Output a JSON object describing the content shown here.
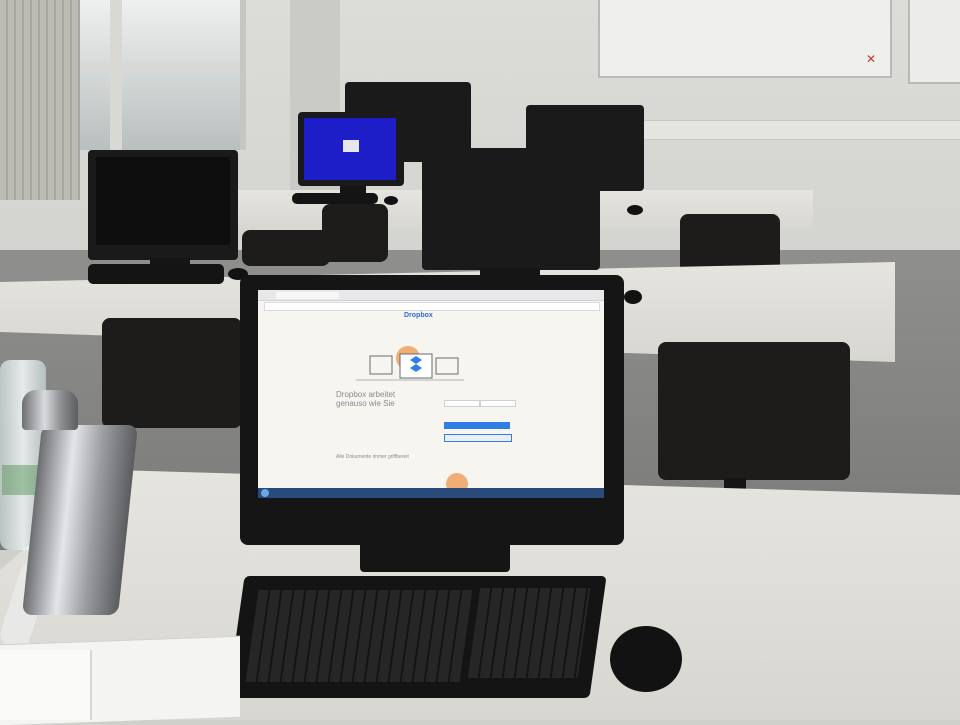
{
  "scene": {
    "description_type": "classroom-photo"
  },
  "front_screen": {
    "brand": "Dropbox",
    "headline": "Dropbox arbeitet genauso wie Sie",
    "body": "",
    "sub_text": "Alle Dokumente immer griffbereit",
    "taskbar": ""
  },
  "colors": {
    "wall": "#dcdcd8",
    "floor": "#8f8f8d",
    "desk": "#e6e4df",
    "monitor": "#1a1a1a",
    "blue_screen": "#1e1ec8",
    "dropbox_blue": "#2f7ee8",
    "accent_orange": "#f0ad76"
  }
}
